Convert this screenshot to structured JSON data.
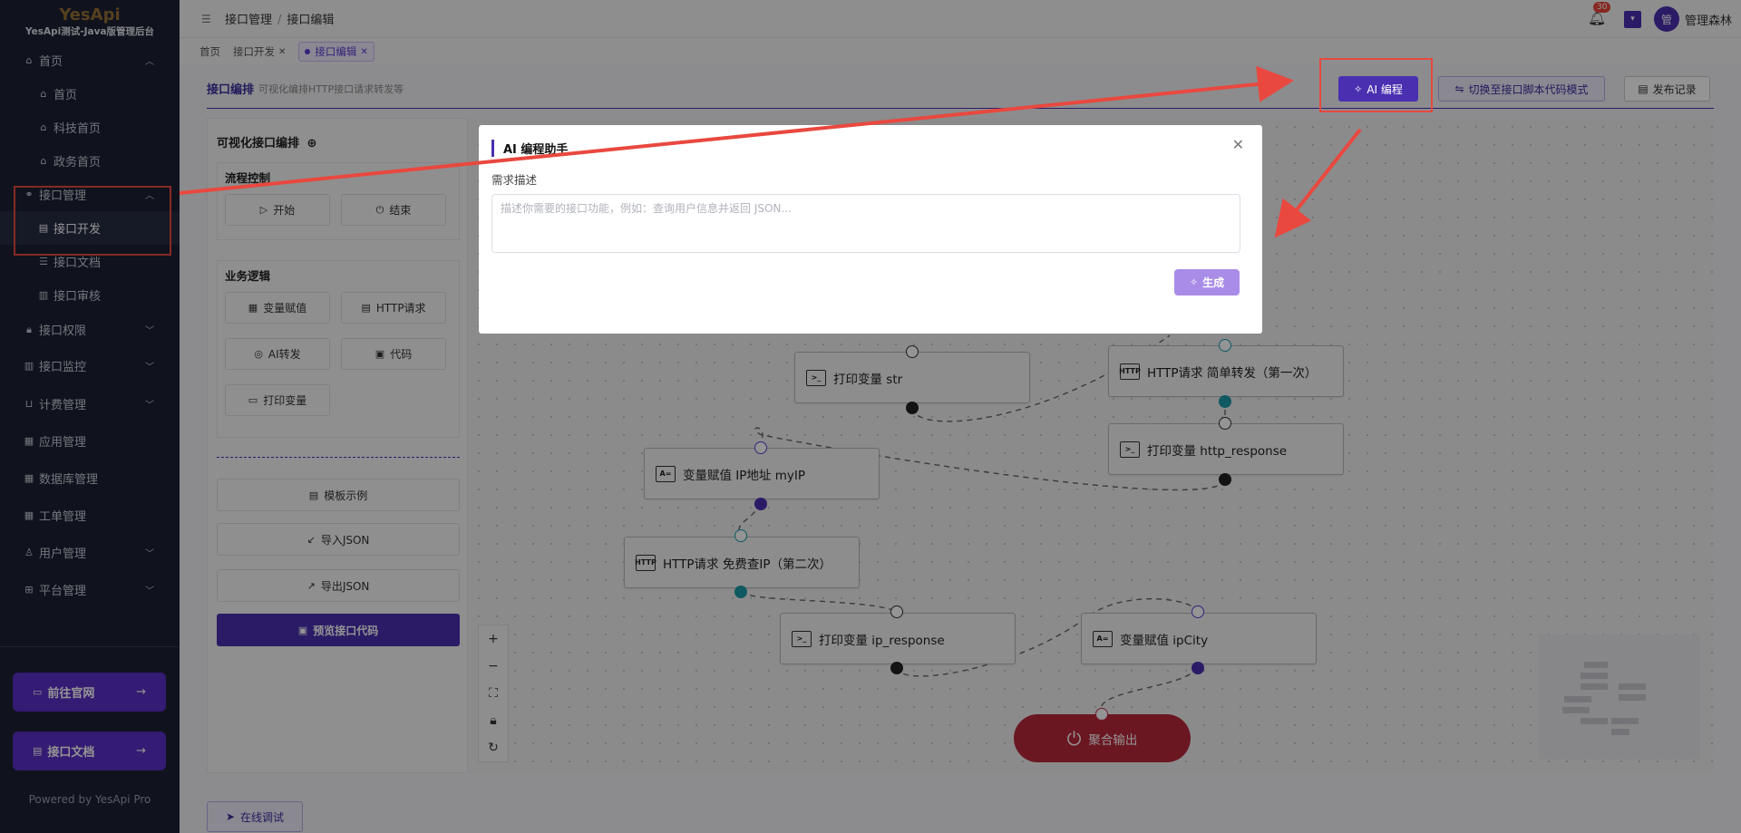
{
  "app": {
    "brand": "YesApi",
    "subtitle": "YesApi测试-Java版管理后台"
  },
  "sidebar": {
    "items": [
      {
        "label": "首页",
        "icon": "home-icon",
        "expanded": true
      },
      {
        "label": "首页",
        "icon": "home-icon",
        "child": true
      },
      {
        "label": "科技首页",
        "icon": "home-icon",
        "child": true
      },
      {
        "label": "政务首页",
        "icon": "home-icon",
        "child": true
      },
      {
        "label": "接口管理",
        "icon": "link-icon",
        "expanded": true
      },
      {
        "label": "接口开发",
        "icon": "doc-icon",
        "child": true,
        "active": true
      },
      {
        "label": "接口文档",
        "icon": "list-icon",
        "child": true
      },
      {
        "label": "接口审核",
        "icon": "bar-icon",
        "child": true
      },
      {
        "label": "接口权限",
        "icon": "lock-icon"
      },
      {
        "label": "接口监控",
        "icon": "bar-icon"
      },
      {
        "label": "计费管理",
        "icon": "cart-icon"
      },
      {
        "label": "应用管理",
        "icon": "app-icon"
      },
      {
        "label": "数据库管理",
        "icon": "db-icon"
      },
      {
        "label": "工单管理",
        "icon": "ticket-icon"
      },
      {
        "label": "用户管理",
        "icon": "user-icon"
      },
      {
        "label": "平台管理",
        "icon": "grid-icon"
      }
    ],
    "btn_site": "前往官网",
    "btn_docs": "接口文档",
    "powered": "Powered by YesApi Pro"
  },
  "header": {
    "breadcrumb": [
      "接口管理",
      "接口编辑"
    ],
    "badge_count": "30",
    "avatar_initial": "管",
    "username": "管理森林"
  },
  "tabs": [
    {
      "label": "首页"
    },
    {
      "label": "接口开发",
      "closable": true
    },
    {
      "label": "接口编辑",
      "closable": true,
      "active": true
    }
  ],
  "page": {
    "title": "接口编排",
    "desc": "可视化编排HTTP接口请求转发等",
    "btn_ai": "AI 编程",
    "btn_switch": "切换至接口脚本代码模式",
    "btn_record": "发布记录"
  },
  "panel": {
    "title": "可视化接口编排",
    "flow_group": "流程控制",
    "btn_start": "开始",
    "btn_end": "结束",
    "logic_group": "业务逻辑",
    "btn_var": "变量赋值",
    "btn_http": "HTTP请求",
    "btn_ai": "AI转发",
    "btn_code": "代码",
    "btn_print": "打印变量",
    "btn_template": "模板示例",
    "btn_import": "导入JSON",
    "btn_export": "导出JSON",
    "btn_preview": "预览接口代码"
  },
  "nodes": {
    "n1": "打印变量 str",
    "n2": "HTTP请求 简单转发（第一次）",
    "n3": "打印变量 http_response",
    "n4": "变量赋值 IP地址 myIP",
    "n5": "HTTP请求 免费查IP（第二次）",
    "n6": "打印变量 ip_response",
    "n7": "变量赋值 ipCity",
    "end": "聚合输出"
  },
  "modal": {
    "title": "AI 编程助手",
    "label": "需求描述",
    "placeholder": "描述你需要的接口功能，例如：查询用户信息并返回 JSON...",
    "btn_generate": "生成"
  },
  "debug_btn": "在线调试",
  "colors": {
    "accent": "#4a2fb0",
    "sidebar": "#1c2133",
    "annotation": "#e9483f",
    "end_node": "#b8283b"
  }
}
